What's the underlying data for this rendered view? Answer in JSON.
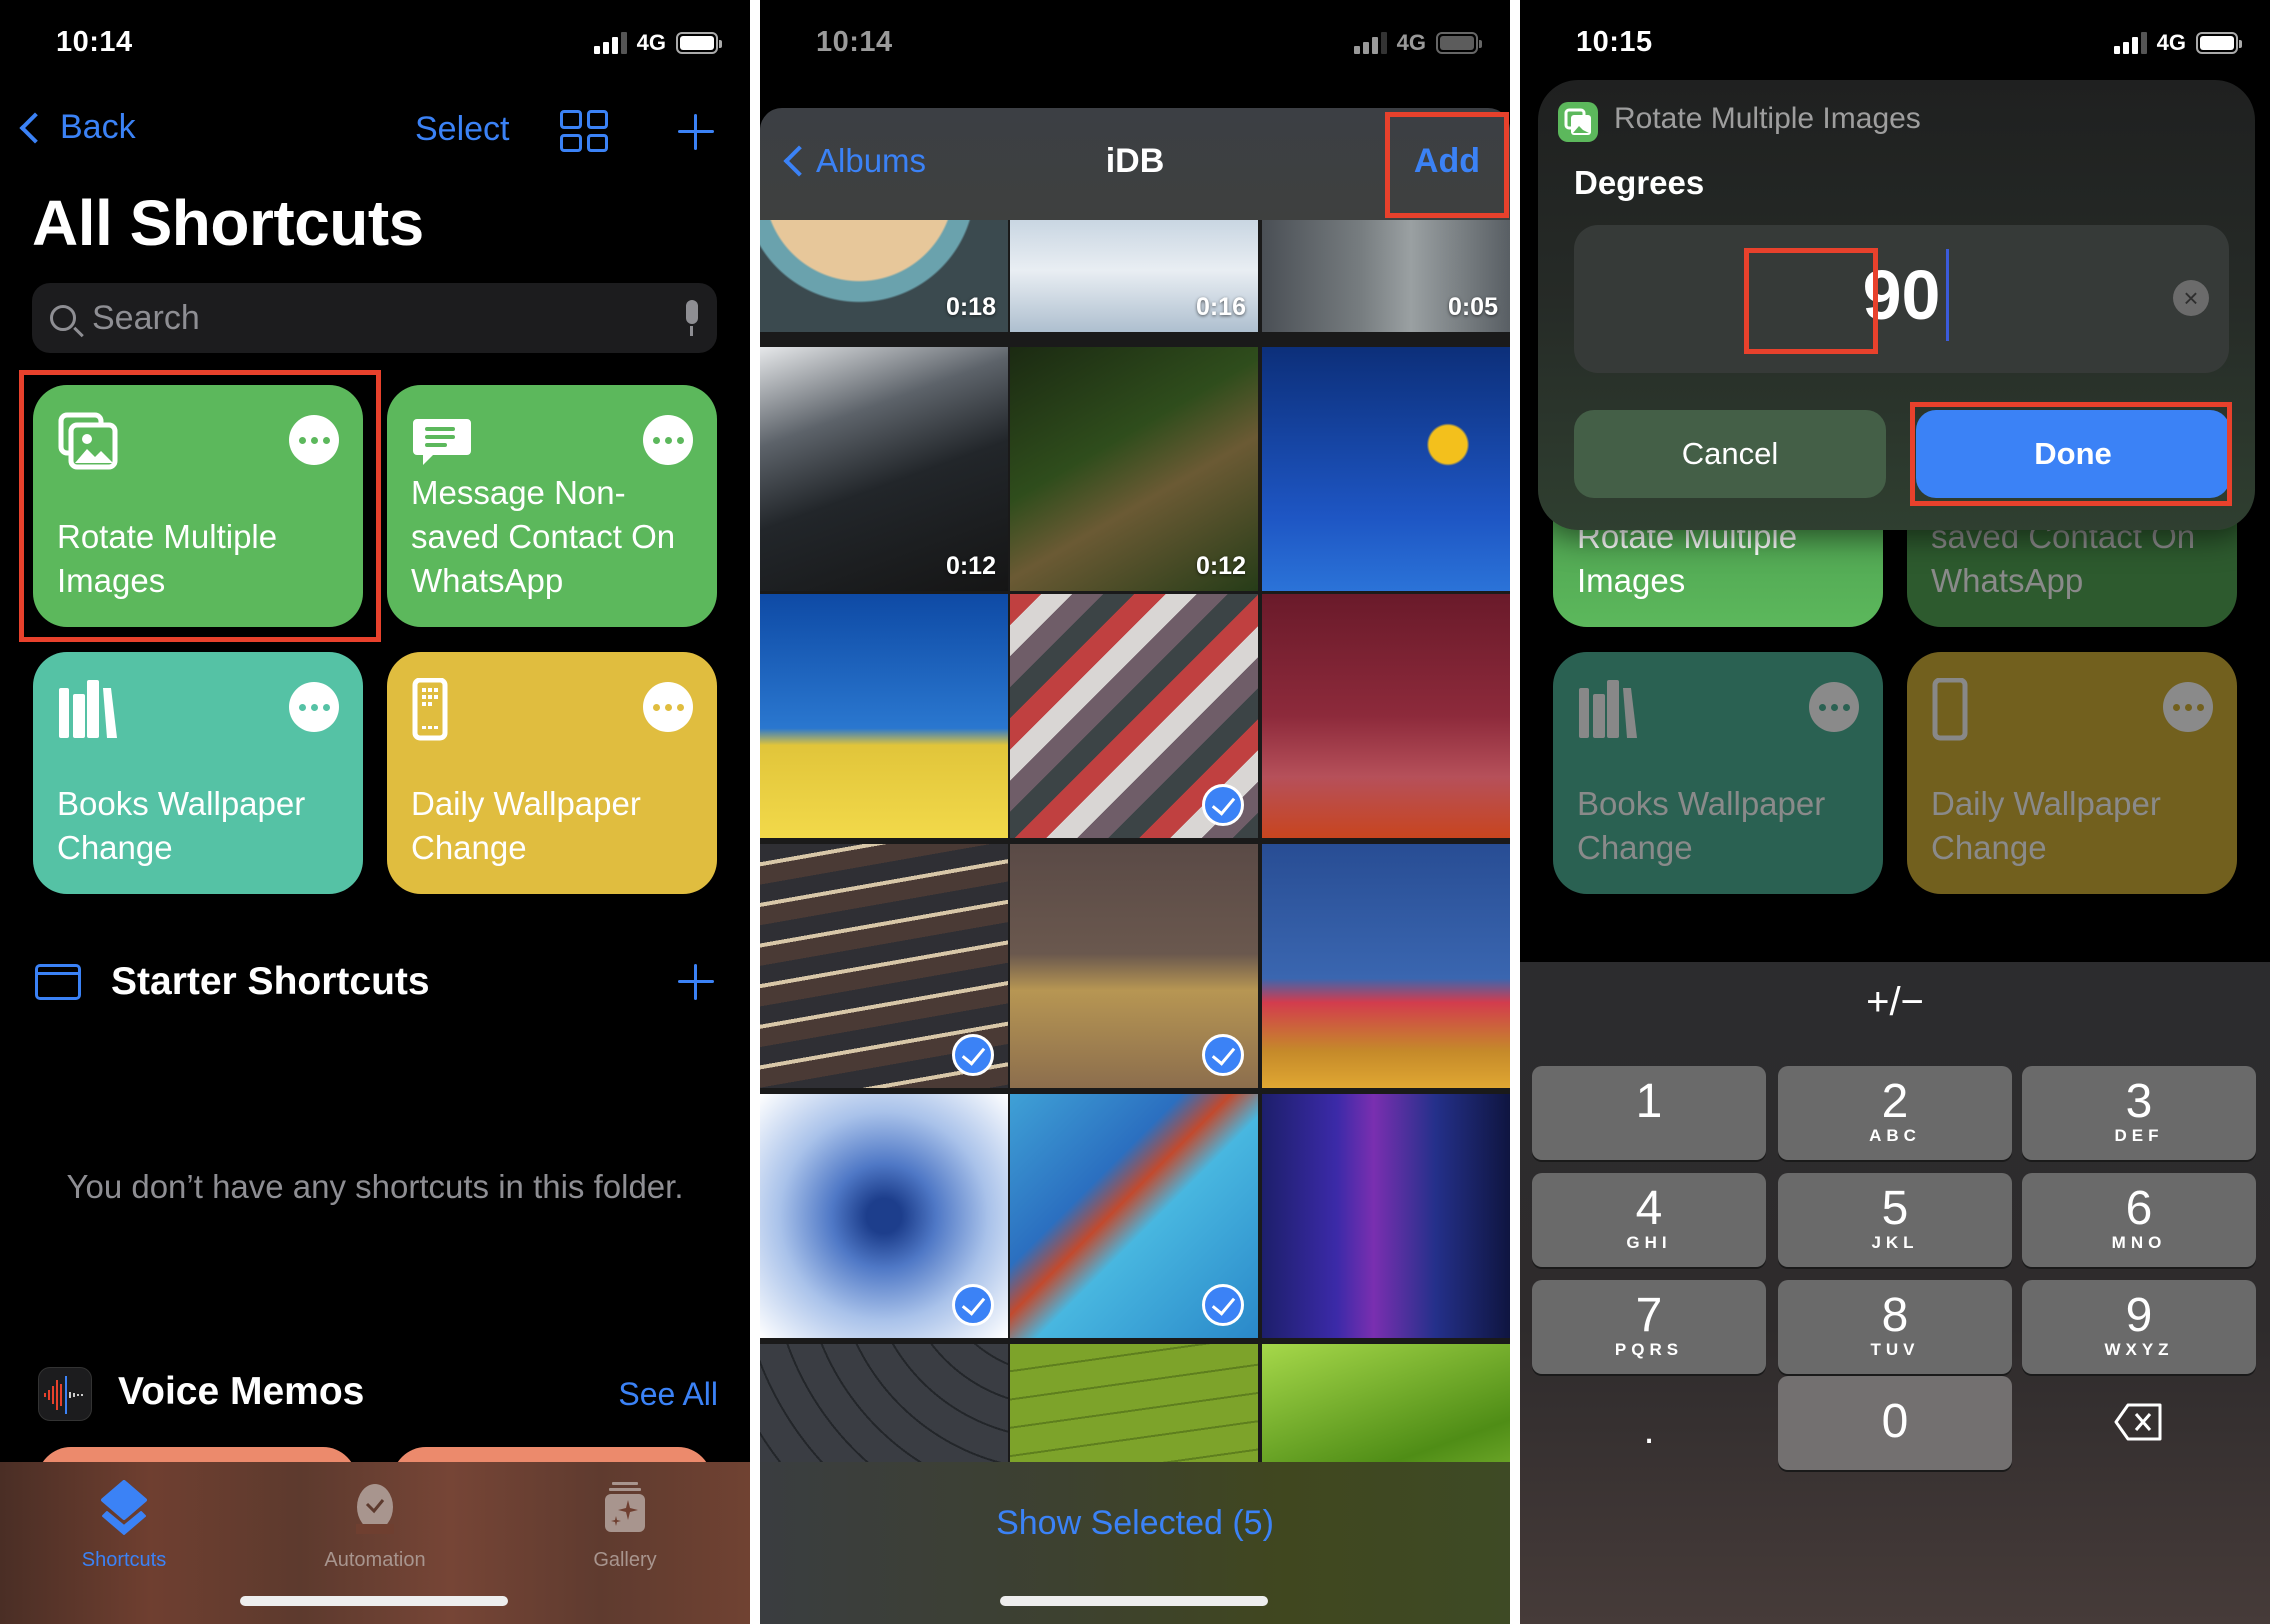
{
  "colors": {
    "accent": "#3b82f6",
    "highlight": "#e8412c",
    "card_green": "#5cb85c",
    "card_teal": "#55c2a5",
    "card_yellow": "#e0bd3f"
  },
  "screens": [
    {
      "status": {
        "time": "10:14",
        "network": "4G"
      },
      "nav": {
        "back_label": "Back",
        "select_label": "Select"
      },
      "title": "All Shortcuts",
      "search": {
        "placeholder": "Search"
      },
      "shortcuts": [
        {
          "name": "Rotate Multiple Images",
          "icon": "photos-icon",
          "color": "#5cb85c",
          "highlighted": true
        },
        {
          "name": "Message Non-saved Contact On WhatsApp",
          "icon": "message-icon",
          "color": "#5cb85c",
          "highlighted": false
        },
        {
          "name": "Books Wallpaper Change",
          "icon": "books-icon",
          "color": "#55c2a5",
          "highlighted": false
        },
        {
          "name": "Daily Wallpaper Change",
          "icon": "phone-grid-icon",
          "color": "#e0bd3f",
          "highlighted": false
        }
      ],
      "folder": {
        "title": "Starter Shortcuts",
        "empty_message": "You don’t have any shortcuts in this folder."
      },
      "voice_memos": {
        "title": "Voice Memos",
        "see_all": "See All"
      },
      "tabs": [
        {
          "label": "Shortcuts",
          "icon": "layers-icon",
          "active": true
        },
        {
          "label": "Automation",
          "icon": "clock-check-icon",
          "active": false
        },
        {
          "label": "Gallery",
          "icon": "gallery-sparkle-icon",
          "active": false
        }
      ]
    },
    {
      "status": {
        "time": "10:14",
        "network": "4G"
      },
      "nav": {
        "back_label": "Albums",
        "title": "iDB",
        "add_label": "Add"
      },
      "photos": [
        {
          "desc": "vinyl record",
          "duration": "0:18",
          "selected": false
        },
        {
          "desc": "clouds",
          "duration": "0:16",
          "selected": false
        },
        {
          "desc": "aerial road traffic",
          "duration": "0:05",
          "selected": false
        },
        {
          "desc": "foggy mountain road",
          "duration": "0:12",
          "selected": false
        },
        {
          "desc": "beehive frame",
          "duration": "0:12",
          "selected": false
        },
        {
          "desc": "yellow flower on blue",
          "duration": null,
          "selected": false
        },
        {
          "desc": "yellow field blue sky",
          "duration": null,
          "selected": false
        },
        {
          "desc": "thread spools",
          "duration": null,
          "selected": true
        },
        {
          "desc": "red sky landscape",
          "duration": null,
          "selected": false
        },
        {
          "desc": "light trails",
          "duration": null,
          "selected": true
        },
        {
          "desc": "infrared grass path",
          "duration": null,
          "selected": true
        },
        {
          "desc": "red trees blue sky",
          "duration": null,
          "selected": false
        },
        {
          "desc": "blue burst",
          "duration": null,
          "selected": true
        },
        {
          "desc": "blue marble fluid",
          "duration": null,
          "selected": true
        },
        {
          "desc": "purple streaks",
          "duration": null,
          "selected": false
        },
        {
          "desc": "grey curves",
          "duration": null,
          "selected": false
        },
        {
          "desc": "green field",
          "duration": null,
          "selected": false
        },
        {
          "desc": "green leaves",
          "duration": null,
          "selected": false
        }
      ],
      "show_selected": "Show Selected (5)"
    },
    {
      "status": {
        "time": "10:15",
        "network": "4G"
      },
      "dialog": {
        "app_name": "Rotate Multiple Images",
        "label": "Degrees",
        "value": "90",
        "cancel_label": "Cancel",
        "done_label": "Done"
      },
      "background_cards": [
        {
          "name": "Rotate Multiple Images",
          "color": "#5cb85c"
        },
        {
          "name": "Message Non-saved Contact On WhatsApp",
          "color": "#2d5a2e"
        },
        {
          "name": "Books Wallpaper Change",
          "color": "#2a6152"
        },
        {
          "name": "Daily Wallpaper Change",
          "color": "#72601e"
        }
      ],
      "keypad": {
        "sign_toggle": "+/−",
        "keys": [
          {
            "num": "1",
            "letters": ""
          },
          {
            "num": "2",
            "letters": "ABC"
          },
          {
            "num": "3",
            "letters": "DEF"
          },
          {
            "num": "4",
            "letters": "GHI"
          },
          {
            "num": "5",
            "letters": "JKL"
          },
          {
            "num": "6",
            "letters": "MNO"
          },
          {
            "num": "7",
            "letters": "PQRS"
          },
          {
            "num": "8",
            "letters": "TUV"
          },
          {
            "num": "9",
            "letters": "WXYZ"
          }
        ],
        "decimal": ".",
        "zero": "0",
        "delete_icon": "backspace-icon"
      }
    }
  ]
}
